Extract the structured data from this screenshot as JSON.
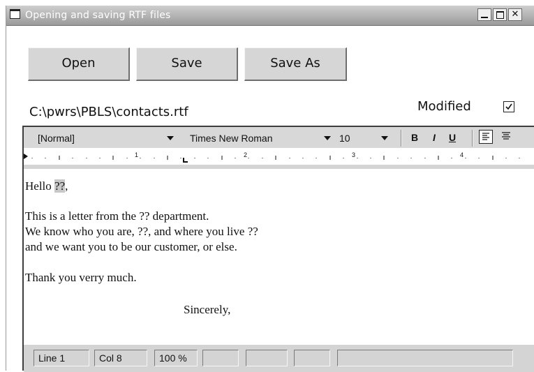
{
  "window": {
    "title": "Opening and saving RTF files",
    "controls": [
      "minimize",
      "maximize",
      "close"
    ]
  },
  "toolbar": {
    "open_label": "Open",
    "save_label": "Save",
    "save_as_label": "Save As"
  },
  "file": {
    "path": "C:\\pwrs\\PBLS\\contacts.rtf",
    "modified_label": "Modified",
    "modified_checked": true
  },
  "format_bar": {
    "style": "[Normal]",
    "font": "Times New Roman",
    "size": "10",
    "bold_label": "B",
    "italic_label": "I",
    "underline_label": "U"
  },
  "ruler": {
    "marks": [
      "1",
      "2",
      "3",
      "4"
    ]
  },
  "document": {
    "greeting_prefix": "Hello ",
    "greeting_field": "??",
    "greeting_suffix": ",",
    "lines": [
      "This is a letter from the ?? department.",
      "We know who you are, ??, and where you live ??",
      "and we want you to be our customer, or else."
    ],
    "thanks": "Thank you verry much.",
    "closing": "Sincerely,"
  },
  "status_bar": {
    "line": "Line  1",
    "col": "Col  8",
    "zoom": "100 %"
  },
  "colors": {
    "titlebar": "#9a9a9a",
    "button_face": "#d6d6d6",
    "field_highlight": "#c8c8c8"
  }
}
